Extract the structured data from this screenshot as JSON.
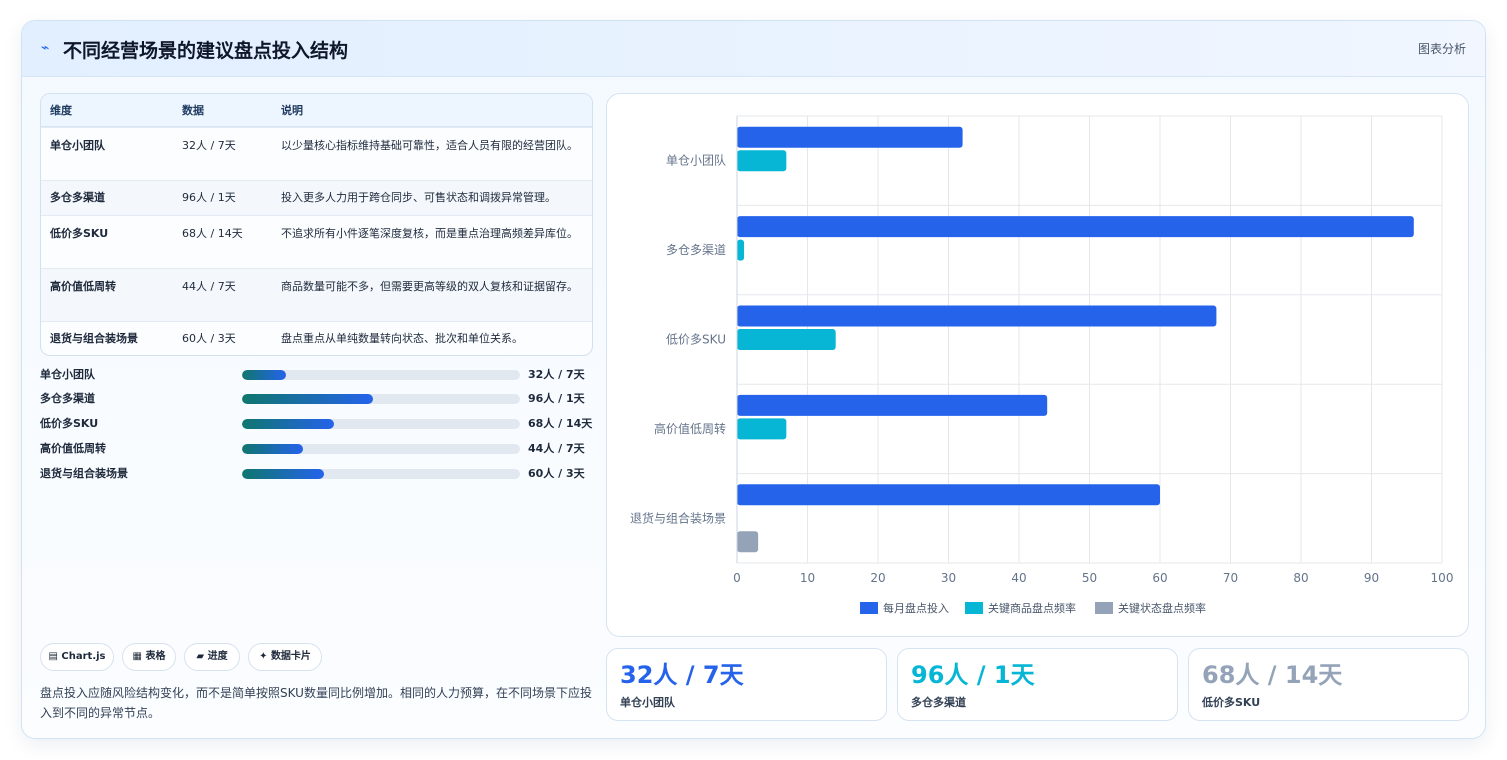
{
  "header": {
    "icon": "chart-line-icon",
    "title": "不同经营场景的建议盘点投入结构",
    "tag": "图表分析"
  },
  "table": {
    "columns": [
      "维度",
      "数据",
      "说明"
    ],
    "rows": [
      [
        "单仓小团队",
        "32人 / 7天",
        "以少量核心指标维持基础可靠性，适合人员有限的经营团队。"
      ],
      [
        "多仓多渠道",
        "96人 / 1天",
        "投入更多人力用于跨仓同步、可售状态和调拨异常管理。"
      ],
      [
        "低价多SKU",
        "68人 / 14天",
        "不追求所有小件逐笔深度复核，而是重点治理高频差异库位。"
      ],
      [
        "高价值低周转",
        "44人 / 7天",
        "商品数量可能不多，但需要更高等级的双人复核和证据留存。"
      ],
      [
        "退货与组合装场景",
        "60人 / 3天",
        "盘点重点从单纯数量转向状态、批次和单位关系。"
      ]
    ]
  },
  "progress": [
    {
      "label": "单仓小团队",
      "value": "32人 / 7天",
      "fraction": 0.16
    },
    {
      "label": "多仓多渠道",
      "value": "96人 / 1天",
      "fraction": 0.47
    },
    {
      "label": "低价多SKU",
      "value": "68人 / 14天",
      "fraction": 0.33
    },
    {
      "label": "高价值低周转",
      "value": "44人 / 7天",
      "fraction": 0.22
    },
    {
      "label": "退货与组合装场景",
      "value": "60人 / 3天",
      "fraction": 0.295
    }
  ],
  "pills": [
    {
      "icon": "chart-icon",
      "glyph": "▤",
      "label": "Chart.js"
    },
    {
      "icon": "table-icon",
      "glyph": "▦",
      "label": "表格"
    },
    {
      "icon": "progress-icon",
      "glyph": "▰",
      "label": "进度"
    },
    {
      "icon": "sparkle-icon",
      "glyph": "✦",
      "label": "数据卡片"
    }
  ],
  "note": "盘点投入应随风险结构变化，而不是简单按照SKU数量同比例增加。相同的人力预算，在不同场景下应投入到不同的异常节点。",
  "stats": [
    {
      "value": "32人 / 7天",
      "label": "单仓小团队",
      "color": "#2563eb"
    },
    {
      "value": "96人 / 1天",
      "label": "多仓多渠道",
      "color": "#06b6d4"
    },
    {
      "value": "68人 / 14天",
      "label": "低价多SKU",
      "color": "#94a3b8"
    }
  ],
  "chart_data": {
    "type": "bar",
    "orientation": "horizontal",
    "categories": [
      "单仓小团队",
      "多仓多渠道",
      "低价多SKU",
      "高价值低周转",
      "退货与组合装场景"
    ],
    "series": [
      {
        "name": "每月盘点投入",
        "values": [
          32,
          96,
          68,
          44,
          60
        ],
        "color": "#2563eb"
      },
      {
        "name": "关键商品盘点频率",
        "values": [
          7,
          1,
          14,
          7,
          null
        ],
        "color": "#06b6d4"
      },
      {
        "name": "关键状态盘点频率",
        "values": [
          null,
          null,
          null,
          null,
          3
        ],
        "color": "#94a3b8"
      }
    ],
    "xlim": [
      0,
      100
    ],
    "xticks": [
      "0",
      "10",
      "20",
      "30",
      "40",
      "50",
      "60",
      "70",
      "80",
      "90",
      "100"
    ],
    "grid": true,
    "legend": "bottom"
  }
}
